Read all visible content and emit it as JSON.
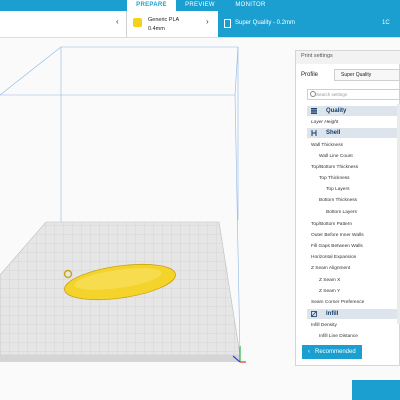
{
  "tabs": [
    {
      "label": "PREPARE"
    },
    {
      "label": "PREVIEW"
    },
    {
      "label": "MONITOR"
    }
  ],
  "material": {
    "name": "Generic PLA",
    "size": "0.4mm"
  },
  "quality": {
    "label": "Super Quality - 0.2mm",
    "right_text": "1C"
  },
  "panel": {
    "title": "Print settings",
    "profile_label": "Profile",
    "profile_value": "Super Quality",
    "search_placeholder": "Search settings",
    "categories": {
      "quality": "Quality",
      "shell": "Shell",
      "infill": "Infill"
    },
    "settings": {
      "layer_height": "Layer Height",
      "wall_thickness": "Wall Thickness",
      "wall_line_count": "Wall Line Count",
      "top_bottom_thickness": "Top/Bottom Thickness",
      "top_thickness": "Top Thickness",
      "top_layers": "Top Layers",
      "bottom_thickness": "Bottom Thickness",
      "bottom_layers": "Bottom Layers",
      "top_bottom_pattern": "Top/Bottom Pattern",
      "outer_before_inner": "Outer Before Inner Walls",
      "fill_gaps": "Fill Gaps Between Walls",
      "horizontal_expansion": "Horizontal Expansion",
      "z_seam_alignment": "Z Seam Alignment",
      "z_seam_x": "Z Seam X",
      "z_seam_y": "Z Seam Y",
      "seam_corner_preference": "Seam Corner Preference",
      "infill_density": "Infill Density",
      "infill_line_distance": "Infill Line Distance"
    },
    "recommended_label": "Recommended"
  },
  "colors": {
    "accent": "#1a9fd0",
    "model": "#f4d32a",
    "plate": "#e6e6e6",
    "category": "#dde4ec"
  }
}
